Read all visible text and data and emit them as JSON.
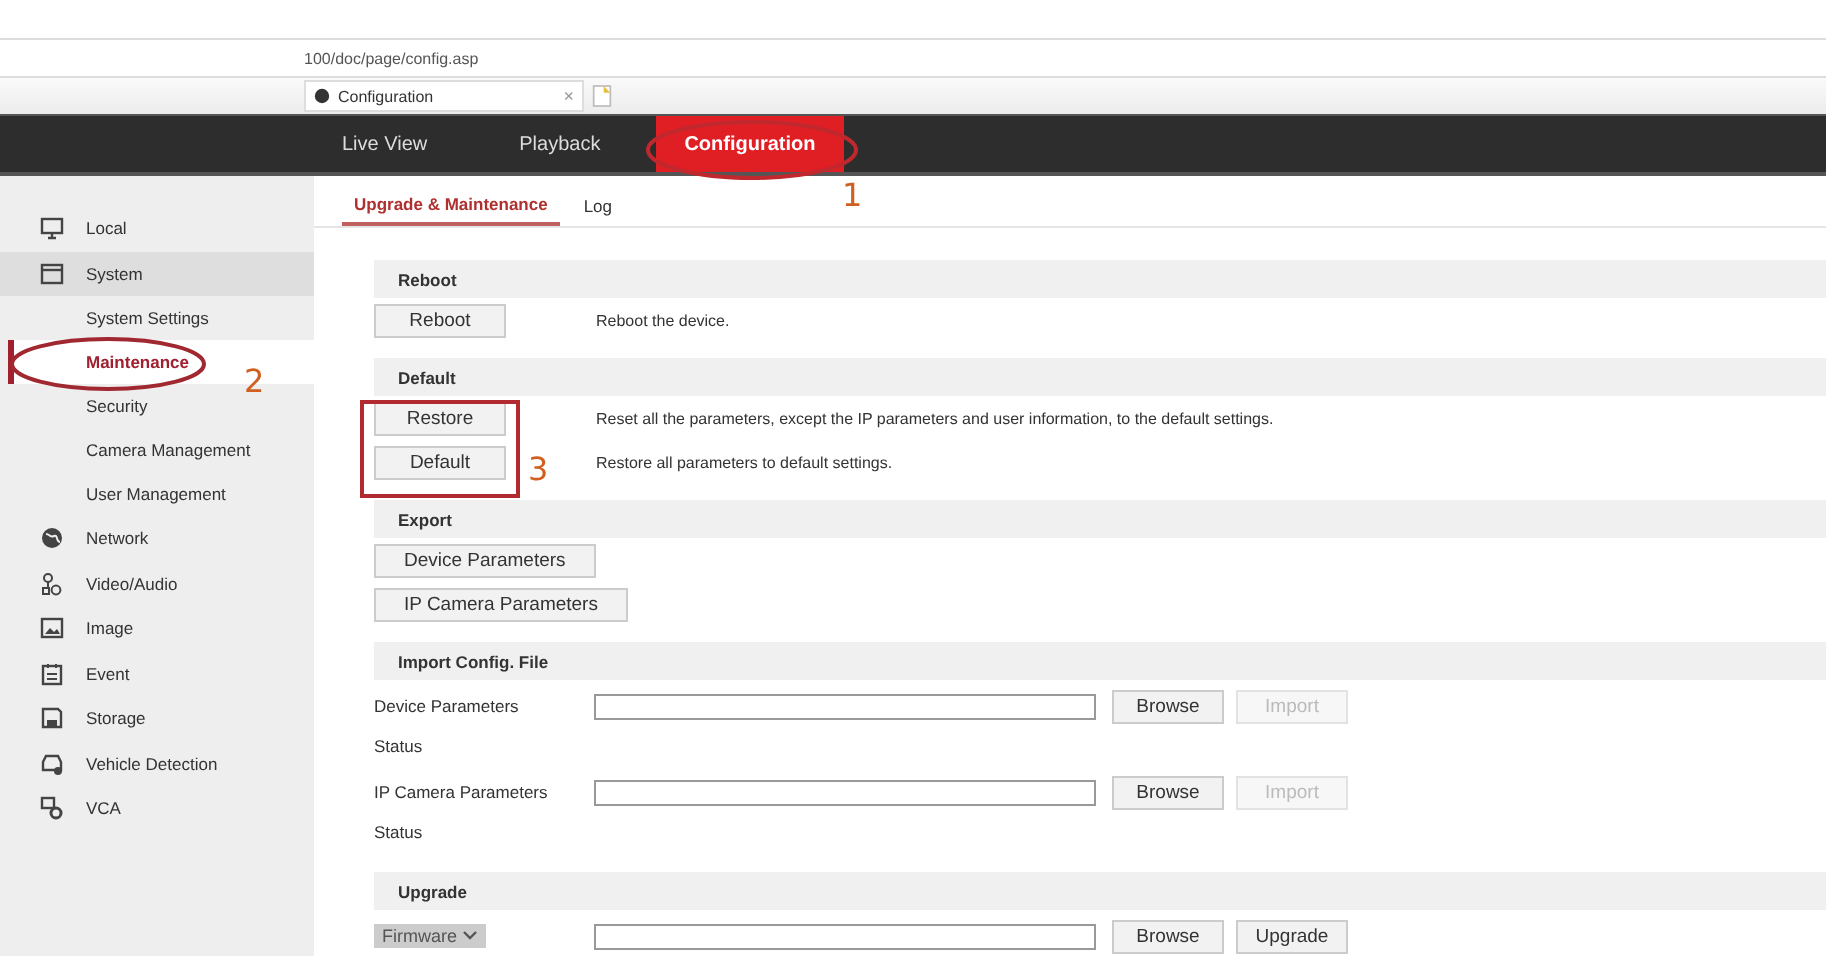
{
  "browser": {
    "address": "100/doc/page/config.asp",
    "tab_title": "Configuration",
    "tab_close": "×"
  },
  "nav": [
    {
      "label": "Live View",
      "selected": false
    },
    {
      "label": "Playback",
      "selected": false
    },
    {
      "label": "Configuration",
      "selected": true
    }
  ],
  "sidebar": [
    {
      "label": "Local",
      "selected": false
    },
    {
      "label": "System",
      "selected": false,
      "expanded": true,
      "children": [
        {
          "label": "System Settings",
          "selected": false
        },
        {
          "label": "Maintenance",
          "selected": true
        },
        {
          "label": "Security",
          "selected": false
        },
        {
          "label": "Camera Management",
          "selected": false
        },
        {
          "label": "User Management",
          "selected": false
        }
      ]
    },
    {
      "label": "Network",
      "selected": false
    },
    {
      "label": "Video/Audio",
      "selected": false
    },
    {
      "label": "Image",
      "selected": false
    },
    {
      "label": "Event",
      "selected": false
    },
    {
      "label": "Storage",
      "selected": false
    },
    {
      "label": "Vehicle Detection",
      "selected": false
    },
    {
      "label": "VCA",
      "selected": false
    }
  ],
  "subtabs": [
    {
      "label": "Upgrade & Maintenance",
      "selected": true
    },
    {
      "label": "Log",
      "selected": false
    }
  ],
  "sections": [
    {
      "kind": "actions",
      "title": "Reboot",
      "rows": [
        {
          "button": "Reboot",
          "description": "Reboot the device."
        }
      ]
    },
    {
      "kind": "actions",
      "title": "Default",
      "rows": [
        {
          "button": "Restore",
          "description": "Reset all the parameters, except the IP parameters and user information, to the default settings."
        },
        {
          "button": "Default",
          "description": "Restore all parameters to default settings."
        }
      ]
    },
    {
      "kind": "actions",
      "title": "Export",
      "rows": [
        {
          "button": "Device Parameters"
        },
        {
          "button": "IP Camera Parameters"
        }
      ]
    },
    {
      "kind": "import",
      "title": "Import Config. File",
      "rows": [
        {
          "label": "Device Parameters",
          "browse": "Browse",
          "action": "Import",
          "disabled": true,
          "status": "Status"
        },
        {
          "label": "IP Camera Parameters",
          "browse": "Browse",
          "action": "Import",
          "disabled": true,
          "status": "Status"
        }
      ]
    },
    {
      "kind": "upgrade",
      "title": "Upgrade",
      "select": "Firmware",
      "browse": "Browse",
      "action": "Upgrade",
      "disabled": false
    }
  ],
  "annotations": [
    {
      "label": "1"
    },
    {
      "label": "2"
    },
    {
      "label": "3"
    }
  ]
}
